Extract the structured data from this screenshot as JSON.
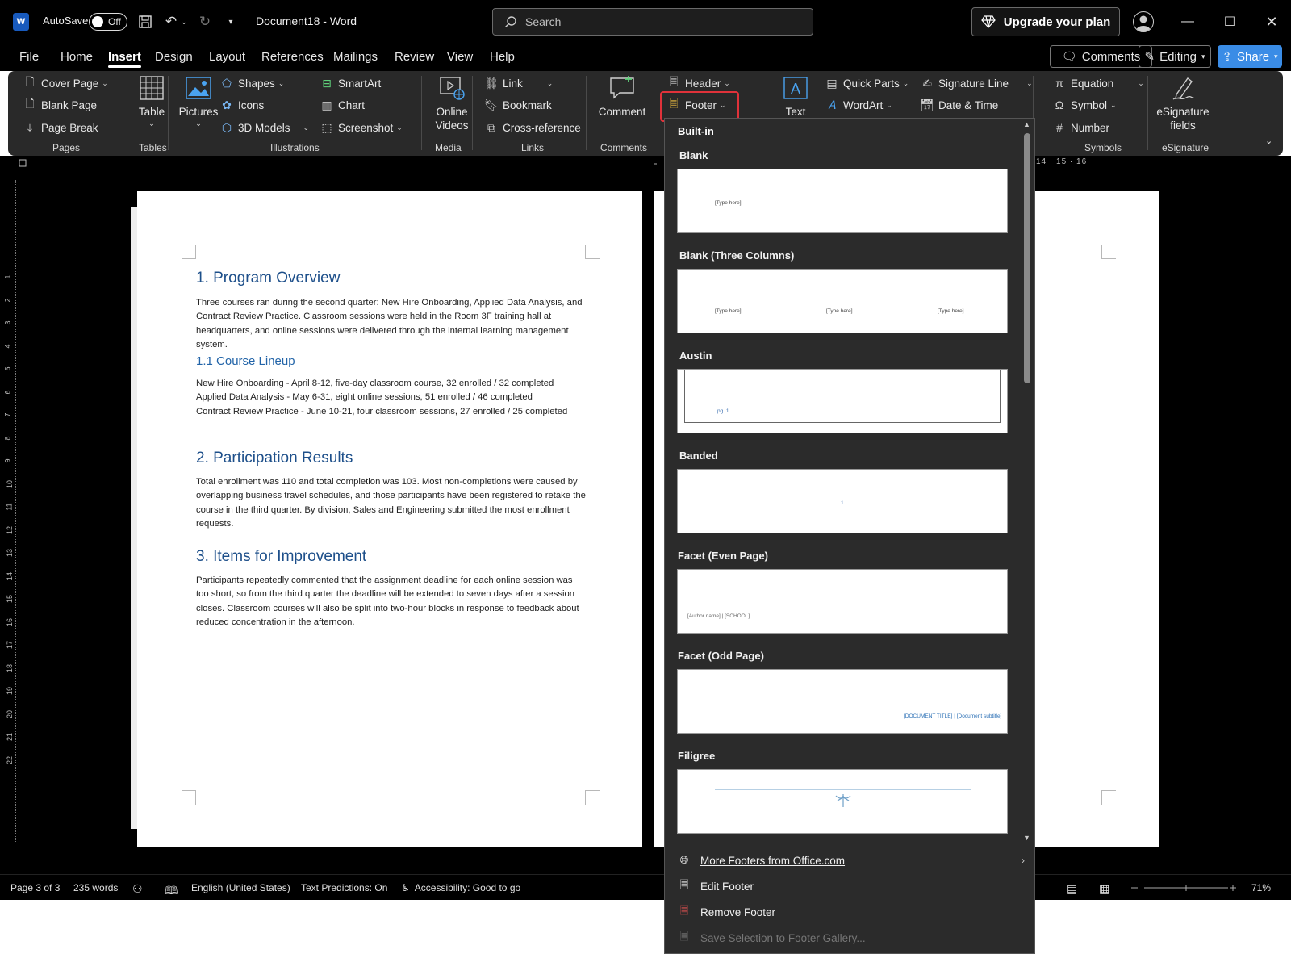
{
  "titlebar": {
    "autosave_label": "AutoSave",
    "autosave_state": "Off",
    "doc_title": "Document18  -  Word",
    "search_placeholder": "Search",
    "upgrade_label": "Upgrade your plan"
  },
  "menu": {
    "tabs": [
      "File",
      "Home",
      "Insert",
      "Design",
      "Layout",
      "References",
      "Mailings",
      "Review",
      "View",
      "Help"
    ],
    "active_tab": "Insert",
    "comments_label": "Comments",
    "editing_label": "Editing",
    "share_label": "Share"
  },
  "ribbon": {
    "pages": {
      "cover_page": "Cover Page",
      "blank_page": "Blank Page",
      "page_break": "Page Break",
      "label": "Pages"
    },
    "tables": {
      "table": "Table",
      "label": "Tables"
    },
    "illustrations": {
      "pictures": "Pictures",
      "shapes": "Shapes",
      "icons": "Icons",
      "models_3d": "3D Models",
      "smartart": "SmartArt",
      "chart": "Chart",
      "screenshot": "Screenshot",
      "label": "Illustrations"
    },
    "media": {
      "online_videos_1": "Online",
      "online_videos_2": "Videos",
      "label": "Media"
    },
    "links": {
      "link": "Link",
      "bookmark": "Bookmark",
      "cross_reference": "Cross-reference",
      "label": "Links"
    },
    "comments": {
      "comment": "Comment",
      "label": "Comments"
    },
    "header_footer": {
      "header": "Header",
      "footer": "Footer"
    },
    "text": {
      "text": "Text",
      "quick_parts": "Quick Parts",
      "wordart": "WordArt",
      "signature_line": "Signature Line",
      "date_time": "Date & Time"
    },
    "symbols": {
      "equation": "Equation",
      "symbol": "Symbol",
      "number": "Number",
      "label": "Symbols"
    },
    "esignature": {
      "fields_1": "eSignature",
      "fields_2": "fields",
      "label": "eSignature"
    }
  },
  "document": {
    "h1_overview": "1. Program Overview",
    "p_overview": "Three courses ran during the second quarter: New Hire Onboarding, Applied Data Analysis, and Contract Review Practice. Classroom sessions were held in the Room 3F training hall at headquarters, and online sessions were delivered through the internal learning management system.",
    "h2_lineup": "1.1 Course Lineup",
    "lineup": [
      "New Hire Onboarding - April 8-12, five-day classroom course, 32 enrolled / 32 completed",
      "Applied Data Analysis - May 6-31, eight online sessions, 51 enrolled / 46 completed",
      "Contract Review Practice - June 10-21, four classroom sessions, 27 enrolled / 25 completed"
    ],
    "h1_results": "2. Participation Results",
    "p_results": "Total enrollment was 110 and total completion was 103. Most non-completions were caused by overlapping business travel schedules, and those participants have been registered to retake the course in the third quarter. By division, Sales and Engineering submitted the most enrollment requests.",
    "h1_improve": "3. Items for Improvement",
    "p_improve": "Participants repeatedly commented that the assignment deadline for each online session was too short, so from the third quarter the deadline will be extended to seven days after a session closes. Classroom courses will also be split into two-hour blocks in response to feedback about reduced concentration in the afternoon."
  },
  "ruler": {
    "vertical_ticks": [
      "1",
      "2",
      "3",
      "4",
      "5",
      "6",
      "7",
      "8",
      "9",
      "10",
      "11",
      "12",
      "13",
      "14",
      "15",
      "16",
      "17",
      "18",
      "19",
      "20",
      "21",
      "22"
    ],
    "horizontal_tail": "14 · 15 · 16"
  },
  "footer_gallery": {
    "section": "Built-in",
    "items": [
      {
        "name": "Blank",
        "texts": [
          "[Type here]"
        ]
      },
      {
        "name": "Blank (Three Columns)",
        "texts": [
          "[Type here]",
          "[Type here]",
          "[Type here]"
        ]
      },
      {
        "name": "Austin",
        "texts": [
          "pg. 1"
        ]
      },
      {
        "name": "Banded",
        "texts": [
          "1"
        ]
      },
      {
        "name": "Facet (Even Page)",
        "texts": [
          "[Author name] | [SCHOOL]"
        ]
      },
      {
        "name": "Facet (Odd Page)",
        "texts": [
          "[DOCUMENT TITLE] | [Document subtitle]"
        ]
      },
      {
        "name": "Filigree",
        "texts": []
      }
    ],
    "menu": {
      "more": "More Footers from Office.com",
      "edit": "Edit Footer",
      "remove": "Remove Footer",
      "save": "Save Selection to Footer Gallery..."
    }
  },
  "status": {
    "page": "Page 3 of 3",
    "words": "235 words",
    "language": "English (United States)",
    "predictions": "Text Predictions: On",
    "accessibility": "Accessibility: Good to go",
    "zoom": "71%"
  },
  "colors": {
    "accent_blue": "#3a8ce6",
    "heading_blue": "#1d4f8a",
    "highlight_red": "#e0323a",
    "ribbon_bg": "#292929"
  }
}
